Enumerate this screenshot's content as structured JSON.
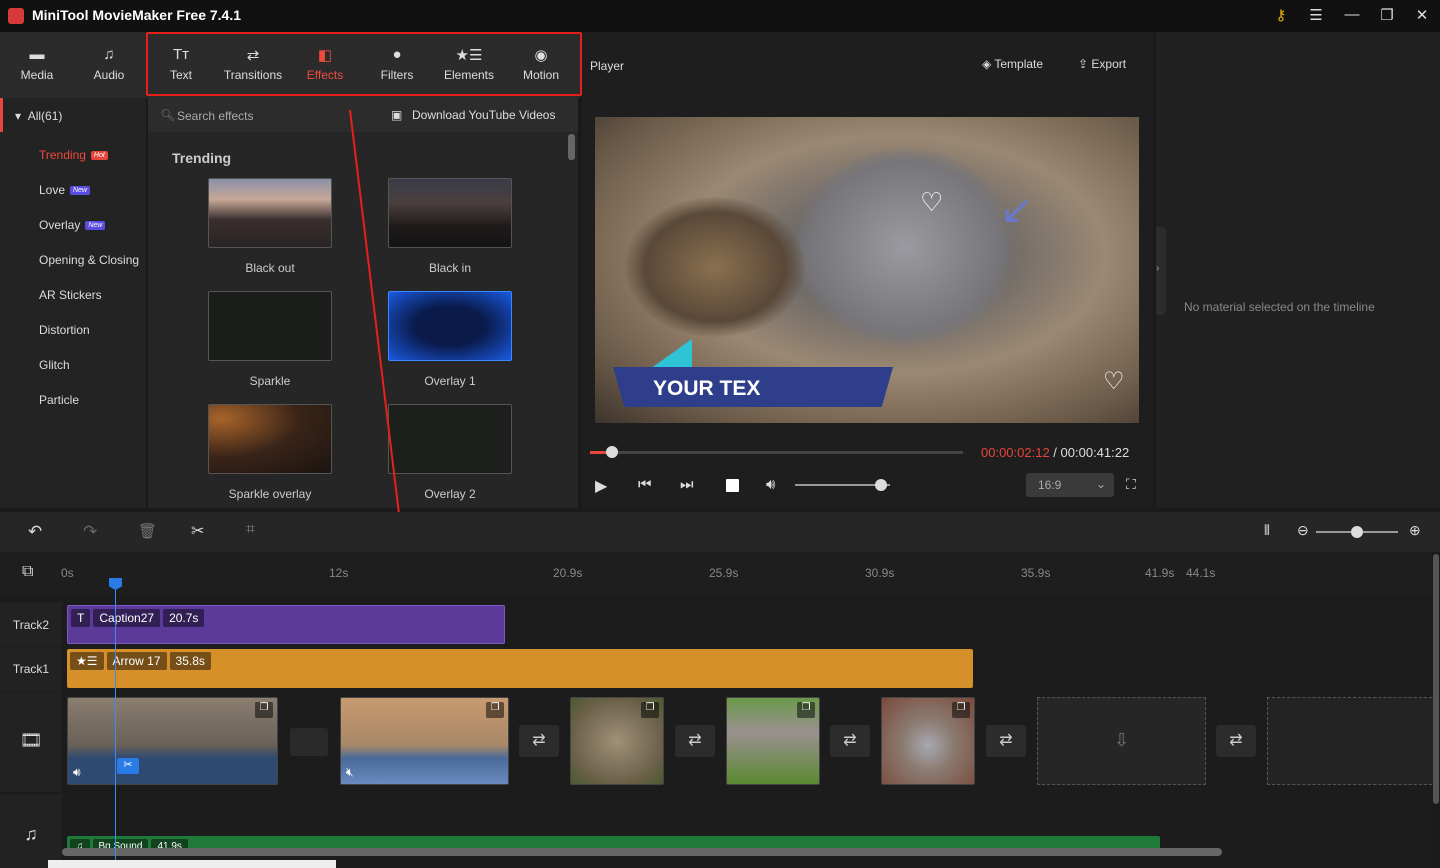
{
  "app": {
    "title": "MiniTool MovieMaker Free 7.4.1"
  },
  "toolbar": {
    "items": [
      {
        "label": "Media",
        "icon": "folder-icon"
      },
      {
        "label": "Audio",
        "icon": "music-icon"
      },
      {
        "label": "Text",
        "icon": "text-icon"
      },
      {
        "label": "Transitions",
        "icon": "swap-icon"
      },
      {
        "label": "Effects",
        "icon": "effects-icon",
        "active": true
      },
      {
        "label": "Filters",
        "icon": "filters-icon"
      },
      {
        "label": "Elements",
        "icon": "elements-icon"
      },
      {
        "label": "Motion",
        "icon": "motion-icon"
      }
    ]
  },
  "categories": {
    "all": "All(61)",
    "items": [
      {
        "label": "Trending",
        "badge": "Hot",
        "active": true
      },
      {
        "label": "Love",
        "badge": "New"
      },
      {
        "label": "Overlay",
        "badge": "New"
      },
      {
        "label": "Opening & Closing"
      },
      {
        "label": "AR Stickers"
      },
      {
        "label": "Distortion"
      },
      {
        "label": "Glitch"
      },
      {
        "label": "Particle"
      }
    ]
  },
  "effects": {
    "search_placeholder": "Search effects",
    "download_label": "Download YouTube Videos",
    "section": "Trending",
    "items": [
      "Black out",
      "Black in",
      "Sparkle",
      "Overlay 1",
      "Sparkle overlay",
      "Overlay 2"
    ]
  },
  "player": {
    "title": "Player",
    "template_label": "Template",
    "export_label": "Export",
    "caption_text": "YOUR TEX",
    "current_time": "00:00:02:12",
    "total_time": "00:00:41:22",
    "progress": 0.06,
    "volume": 0.9,
    "aspect": "16:9"
  },
  "properties": {
    "empty_text": "No material selected on the timeline"
  },
  "timeline": {
    "ticks": [
      "0s",
      "12s",
      "20.9s",
      "25.9s",
      "30.9s",
      "35.9s",
      "41.9s",
      "44.1s"
    ],
    "zoom_level": 0.5,
    "tracks": {
      "track2": "Track2",
      "track1": "Track1"
    },
    "caption_clip": {
      "name": "Caption27",
      "duration": "20.7s",
      "color": "#5b3a9a"
    },
    "element_clip": {
      "name": "Arrow 17",
      "duration": "35.8s",
      "color": "#d6902a"
    },
    "audio_clip": {
      "name": "Bg Sound",
      "duration": "41.9s"
    }
  }
}
